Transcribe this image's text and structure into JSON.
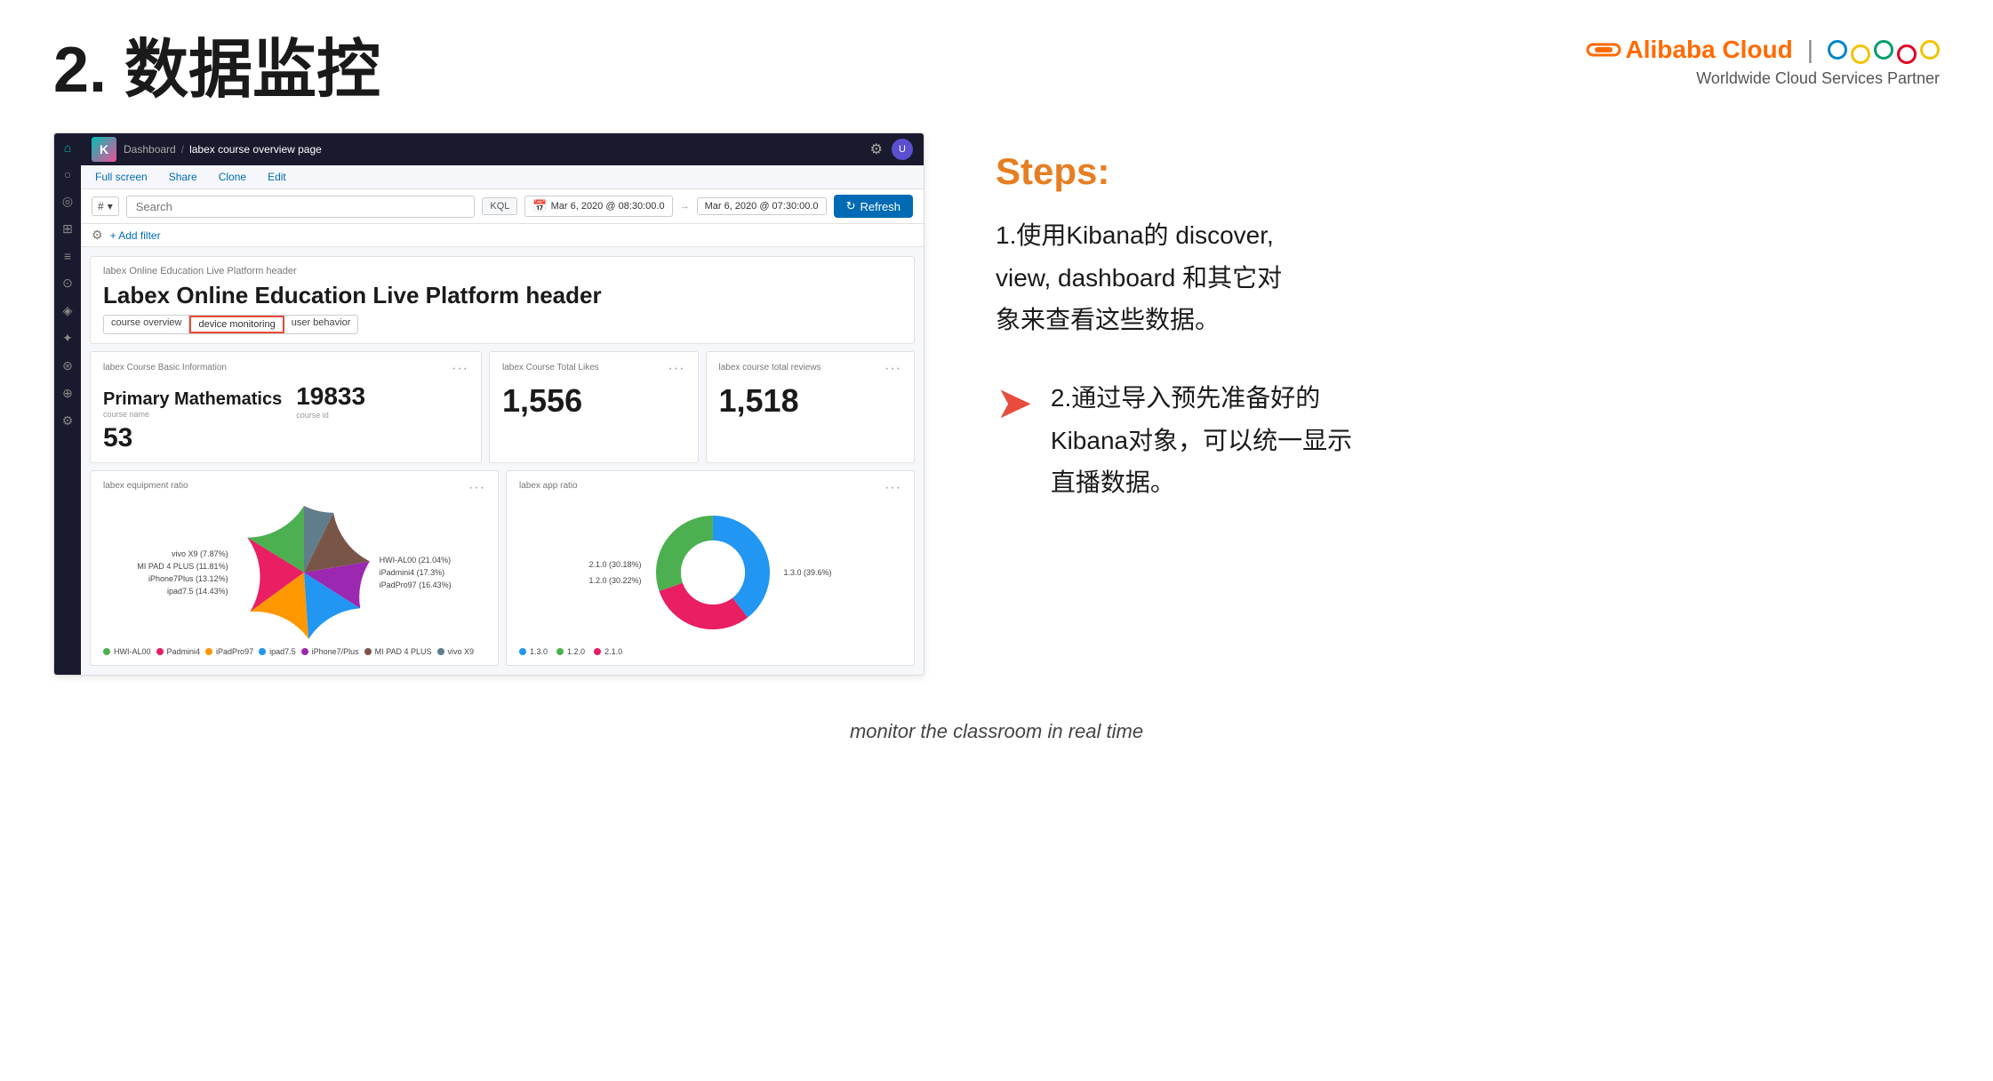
{
  "header": {
    "title": "2. 数据监控",
    "brand": {
      "name": "Alibaba Cloud",
      "subtitle": "Worldwide Cloud Services Partner",
      "icon_symbol": "⊖"
    }
  },
  "kibana": {
    "topbar": {
      "breadcrumb_root": "Dashboard",
      "breadcrumb_current": "labex course overview page"
    },
    "toolbar": {
      "full_screen": "Full screen",
      "share": "Share",
      "clone": "Clone",
      "edit": "Edit"
    },
    "search": {
      "type_prefix": "#",
      "placeholder": "Search",
      "kql_label": "KQL",
      "time_from": "Mar 6, 2020 @ 08:30:00.0",
      "time_to": "Mar 6, 2020 @ 07:30:00.0",
      "refresh_label": "Refresh"
    },
    "filter": {
      "add_filter": "+ Add filter"
    },
    "panels": {
      "header_panel": {
        "title": "labex Online Education Live Platform header",
        "big_text": "Labex Online Education Live Platform header",
        "tabs": [
          {
            "label": "course overview",
            "active": false
          },
          {
            "label": "device monitoring",
            "active": true
          },
          {
            "label": "user behavior",
            "active": false
          }
        ]
      },
      "basic_info": {
        "title": "labex Course Basic Information",
        "course_name": "Primary Mathematics",
        "course_name_label": "course name",
        "course_id": "19833",
        "course_id_label": "course id",
        "extra_number": "53"
      },
      "total_likes": {
        "title": "labex Course Total Likes",
        "value": "1,556"
      },
      "total_reviews": {
        "title": "labex course total reviews",
        "value": "1,518"
      },
      "equipment_ratio": {
        "title": "labex equipment ratio",
        "legend": [
          {
            "label": "HWI-AL00",
            "color": "#4CAF50",
            "percent": 21.04
          },
          {
            "label": "Padmini4",
            "color": "#E91E63",
            "percent": 17.3
          },
          {
            "label": "iPadPro97",
            "color": "#FF9800",
            "percent": 16.43
          },
          {
            "label": "ipad7.5",
            "color": "#2196F3",
            "percent": 14.43
          },
          {
            "label": "iPhone7/Plus",
            "color": "#9C27B0",
            "percent": 13.12
          },
          {
            "label": "MI PAD 4 PLUS",
            "color": "#795548",
            "percent": 11.81
          },
          {
            "label": "vivo X9",
            "color": "#607D8B",
            "percent": 7.87
          }
        ],
        "labels_on_chart": [
          {
            "label": "HWI-AL00 (21.04%)",
            "pos": "top-right"
          },
          {
            "label": "iPadmini4 (17.3%)",
            "pos": "right"
          },
          {
            "label": "iPadPro97 (16.43%)",
            "pos": "bottom-right"
          },
          {
            "label": "ipad7.5 (14.43%)",
            "pos": "bottom-left"
          },
          {
            "label": "iPhone7Plus (13.12%)",
            "pos": "left"
          },
          {
            "label": "MI PAD 4 PLUS (11.81%)",
            "pos": "upper-left"
          },
          {
            "label": "vivo X9 (7.87%)",
            "pos": "top-left"
          }
        ]
      },
      "app_ratio": {
        "title": "labex app ratio",
        "segments": [
          {
            "label": "1.3.0",
            "color": "#2196F3",
            "percent": 39.6
          },
          {
            "label": "1.2.0",
            "color": "#4CAF50",
            "percent": 30.22
          },
          {
            "label": "2.1.0",
            "color": "#E91E63",
            "percent": 30.18
          }
        ],
        "labels_on_chart": [
          {
            "label": "1.3.0 (39.6%)",
            "pos": "right"
          },
          {
            "label": "2.1.0 (30.18%)",
            "pos": "top"
          },
          {
            "label": "1.2.0 (30.22%)",
            "pos": "bottom"
          }
        ]
      }
    }
  },
  "right_panel": {
    "steps_title": "Steps:",
    "step1_text": "1.使用Kibana的 discover,\nview, dashboard 和其它对\n象来查看这些数据。",
    "step2_text": "2.通过导入预先准备好的\nKibana对象，可以统一显示\n直播数据。"
  },
  "footer": {
    "text": "monitor the classroom in real time"
  },
  "sidebar_icons": [
    "◎",
    "🏠",
    "📋",
    "🔖",
    "⚙",
    "🔍",
    "📊",
    "🔔",
    "🔒",
    "📁",
    "⊕"
  ]
}
